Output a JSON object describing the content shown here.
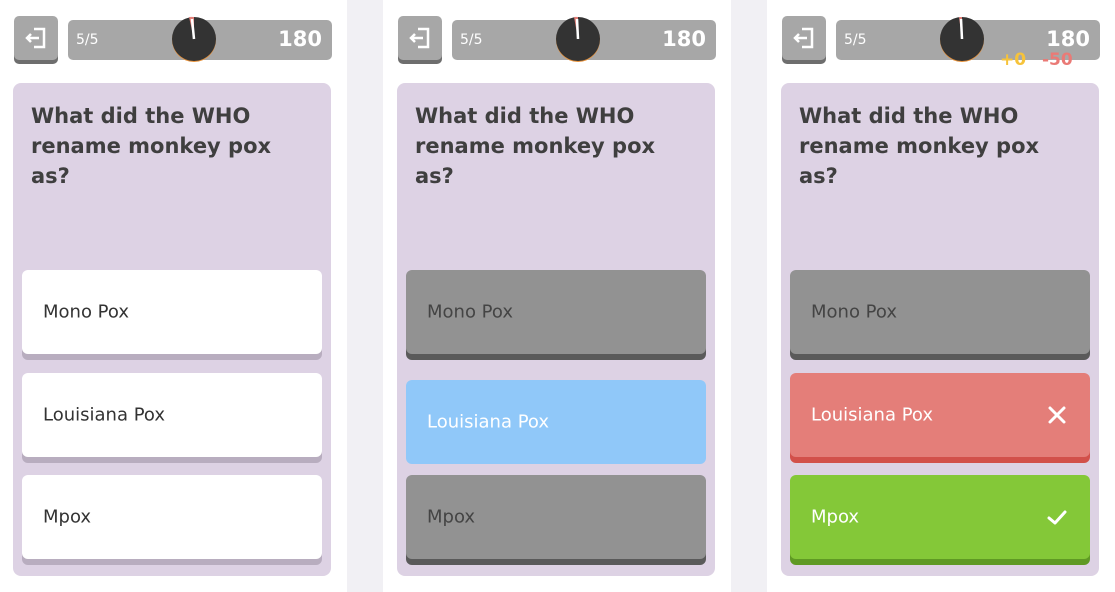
{
  "colors": {
    "card_bg": "#ddd2e4",
    "bar_bg": "#a7a7a7",
    "answer_default": "#ffffff",
    "answer_dimmed": "#929292",
    "answer_selected": "#90c8f9",
    "answer_wrong": "#e47e79",
    "answer_correct": "#84c838",
    "bonus": "#f6c33a",
    "penalty": "#ea7a76"
  },
  "screens": [
    {
      "progress": "5/5",
      "score": "180",
      "question": "What did the WHO rename monkey pox as?",
      "answers": [
        {
          "label": "Mono Pox",
          "state": "default"
        },
        {
          "label": "Louisiana Pox",
          "state": "default"
        },
        {
          "label": "Mpox",
          "state": "default"
        }
      ]
    },
    {
      "progress": "5/5",
      "score": "180",
      "question": "What did the WHO rename monkey pox as?",
      "answers": [
        {
          "label": "Mono Pox",
          "state": "dimmed"
        },
        {
          "label": "Louisiana Pox",
          "state": "selected"
        },
        {
          "label": "Mpox",
          "state": "dimmed"
        }
      ]
    },
    {
      "progress": "5/5",
      "score": "180",
      "score_bonus": "+0",
      "score_penalty": "-50",
      "question": "What did the WHO rename monkey pox as?",
      "answers": [
        {
          "label": "Mono Pox",
          "state": "dimmed"
        },
        {
          "label": "Louisiana Pox",
          "state": "wrong",
          "icon": "cross-icon"
        },
        {
          "label": "Mpox",
          "state": "correct",
          "icon": "check-icon"
        }
      ]
    }
  ]
}
